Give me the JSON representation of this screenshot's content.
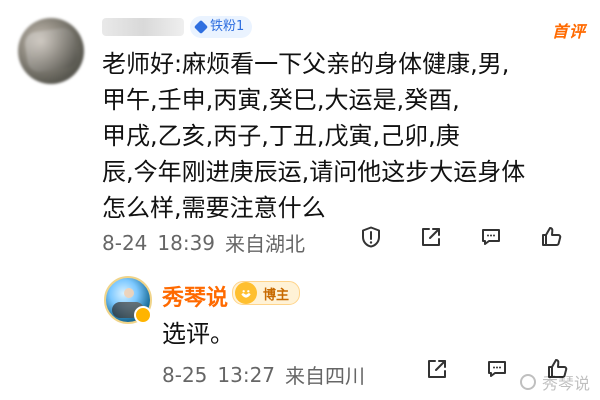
{
  "comment": {
    "badge": {
      "icon": "diamond-icon",
      "label": "铁粉1"
    },
    "first_comment_label": "首评",
    "text": "老师好:麻烦看一下父亲的身体健康,男,\n甲午,壬申,丙寅,癸巳,大运是,癸酉,\n甲戌,乙亥,丙子,丁丑,戊寅,己卯,庚\n辰,今年刚进庚辰运,请问他这步大运身体\n怎么样,需要注意什么",
    "meta": {
      "date": "8-24",
      "time": "18:39",
      "location": "来自湖北"
    },
    "actions": [
      "report-icon",
      "share-icon",
      "reply-icon",
      "like-icon"
    ]
  },
  "reply": {
    "name": "秀琴说",
    "blogger_badge": "博主",
    "text": "选评。",
    "meta": {
      "date": "8-25",
      "time": "13:27",
      "location": "来自四川"
    },
    "actions": [
      "share-icon",
      "reply-icon",
      "like-icon"
    ]
  },
  "watermark": {
    "text": "秀琴说"
  }
}
